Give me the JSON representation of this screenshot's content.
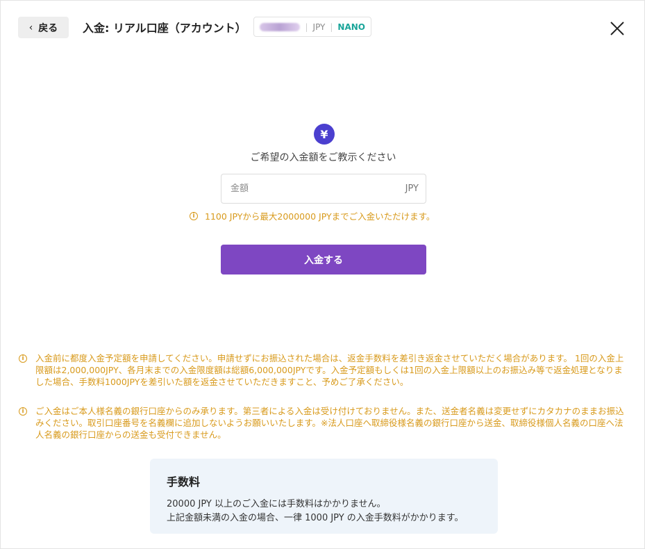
{
  "header": {
    "back_label": "戻る",
    "title": "入金: リアル口座（アカウント）",
    "account_currency": "JPY",
    "account_type": "NANO"
  },
  "deposit": {
    "prompt": "ご希望の入金額をご教示ください",
    "amount_placeholder": "金額",
    "amount_value": "",
    "unit": "JPY",
    "limit_hint": "1100 JPYから最大2000000 JPYまでご入金いただけます。",
    "submit_label": "入金する"
  },
  "notices": [
    "入金前に都度入金予定額を申請してください。申請せずにお振込された場合は、返金手数料を差引き返金させていただく場合があります。 1回の入金上限額は2,000,000JPY、各月末までの入金限度額は総額6,000,000JPYです。入金予定額もしくは1回の入金上限額以上のお振込み等で返金処理となりました場合、手数料1000JPYを差引いた額を返金させていただきますこと、予めご了承ください。",
    "ご入金はご本人様名義の銀行口座からのみ承ります。第三者による入金は受け付けておりません。また、送金者名義は変更せずにカタカナのままお振込みください。取引口座番号を名義欄に追加しないようお願いいたします。※法人口座へ取締役様名義の銀行口座から送金、取締役様個人名義の口座へ法人名義の銀行口座からの送金も受付できません。"
  ],
  "fee": {
    "title": "手数料",
    "line1": "20000 JPY 以上のご入金には手数料はかかりません。",
    "line2": "上記金額未満の入金の場合、一律 1000 JPY の入金手数料がかかります。"
  },
  "icons": {
    "back": "chevron-left-icon",
    "close": "close-icon",
    "currency": "yen-icon",
    "info": "info-icon"
  },
  "colors": {
    "primary": "#7e47c2",
    "yen_badge": "#4b3fcf",
    "warning": "#d89a1c",
    "nano": "#1aa59a",
    "fee_card_bg": "#eef4fa"
  }
}
